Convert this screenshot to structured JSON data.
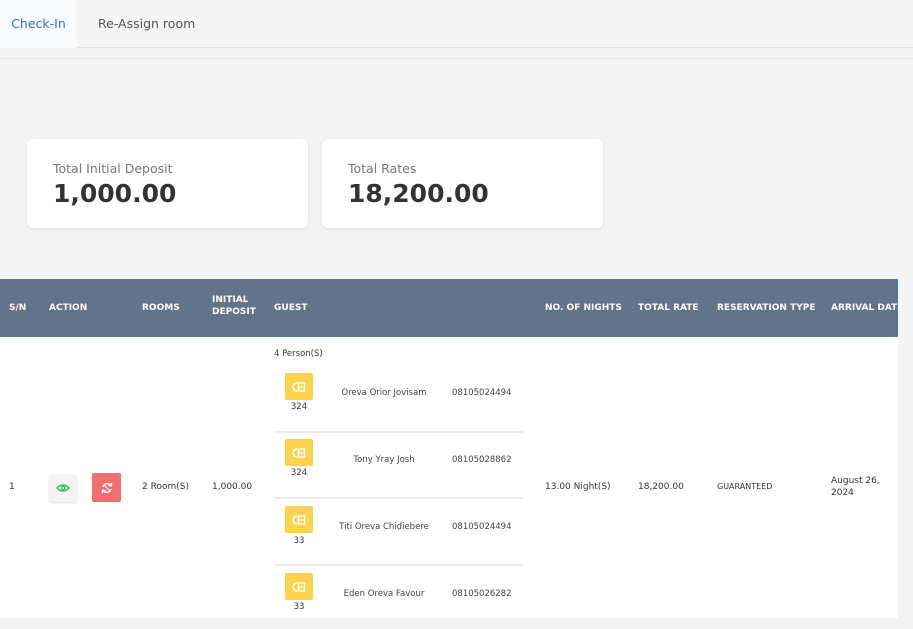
{
  "tabs": [
    {
      "label": "Check-In",
      "active": true
    },
    {
      "label": "Re-Assign room",
      "active": false
    }
  ],
  "summary": {
    "total_initial_deposit_label": "Total Initial Deposit",
    "total_initial_deposit_value": "1,000.00",
    "total_rates_label": "Total Rates",
    "total_rates_value": "18,200.00"
  },
  "table": {
    "headers": {
      "sn": "S/N",
      "action": "ACTION",
      "rooms": "ROOMS",
      "initial_deposit": "INITIAL DEPOSIT",
      "guest": "GUEST",
      "nights": "NO. OF NIGHTS",
      "total_rate": "TOTAL RATE",
      "reservation_type": "RESERVATION TYPE",
      "arrival_date": "ARRIVAL DATE"
    },
    "row": {
      "sn": "1",
      "rooms": "2 Room(S)",
      "initial_deposit": "1,000.00",
      "guest_count": "4 Person(S)",
      "guests": [
        {
          "room": "324",
          "name": "Oreva Orior Jovisam",
          "phone": "08105024494"
        },
        {
          "room": "324",
          "name": "Tony Yray Josh",
          "phone": "08105028862"
        },
        {
          "room": "33",
          "name": "Titi Oreva Chidiebere",
          "phone": "08105024494"
        },
        {
          "room": "33",
          "name": "Eden Oreva Favour",
          "phone": "08105026282"
        }
      ],
      "nights": "13.00 Night(S)",
      "total_rate": "18,200.00",
      "reservation_type": "GUARANTEED",
      "arrival_date": "August 26, 2024"
    }
  },
  "icons": {
    "view": "eye-icon",
    "reassign": "swap-icon",
    "room": "room-key-icon"
  },
  "colors": {
    "accent": "#3b6fd6",
    "header_bg": "#63738a",
    "view_icon": "#2fbf71",
    "reassign_bg": "#f07070",
    "room_badge": "#fcd34d"
  }
}
